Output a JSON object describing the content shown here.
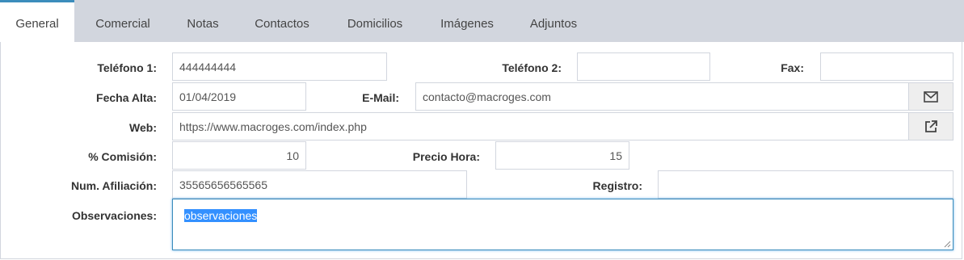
{
  "tabs": [
    "General",
    "Comercial",
    "Notas",
    "Contactos",
    "Domicilios",
    "Imágenes",
    "Adjuntos"
  ],
  "labels": {
    "telefono1": "Teléfono 1:",
    "telefono2": "Teléfono 2:",
    "fax": "Fax:",
    "fecha_alta": "Fecha Alta:",
    "email": "E-Mail:",
    "web": "Web:",
    "comision": "% Comisión:",
    "precio_hora": "Precio Hora:",
    "num_afiliacion": "Num. Afiliación:",
    "registro": "Registro:",
    "observaciones": "Observaciones:"
  },
  "values": {
    "telefono1": "444444444",
    "telefono2": "",
    "fax": "",
    "fecha_alta": "01/04/2019",
    "email": "contacto@macroges.com",
    "web": "https://www.macroges.com/index.php",
    "comision": "10",
    "precio_hora": "15",
    "num_afiliacion": "35565656565565",
    "registro": "",
    "observaciones": "observaciones"
  },
  "icons": {
    "email_button": "envelope-icon",
    "web_button": "external-link-icon"
  },
  "colors": {
    "tab_active_border": "#3c8dbc",
    "tab_bar": "#d2d6de",
    "focus": "#3c8dbc"
  }
}
